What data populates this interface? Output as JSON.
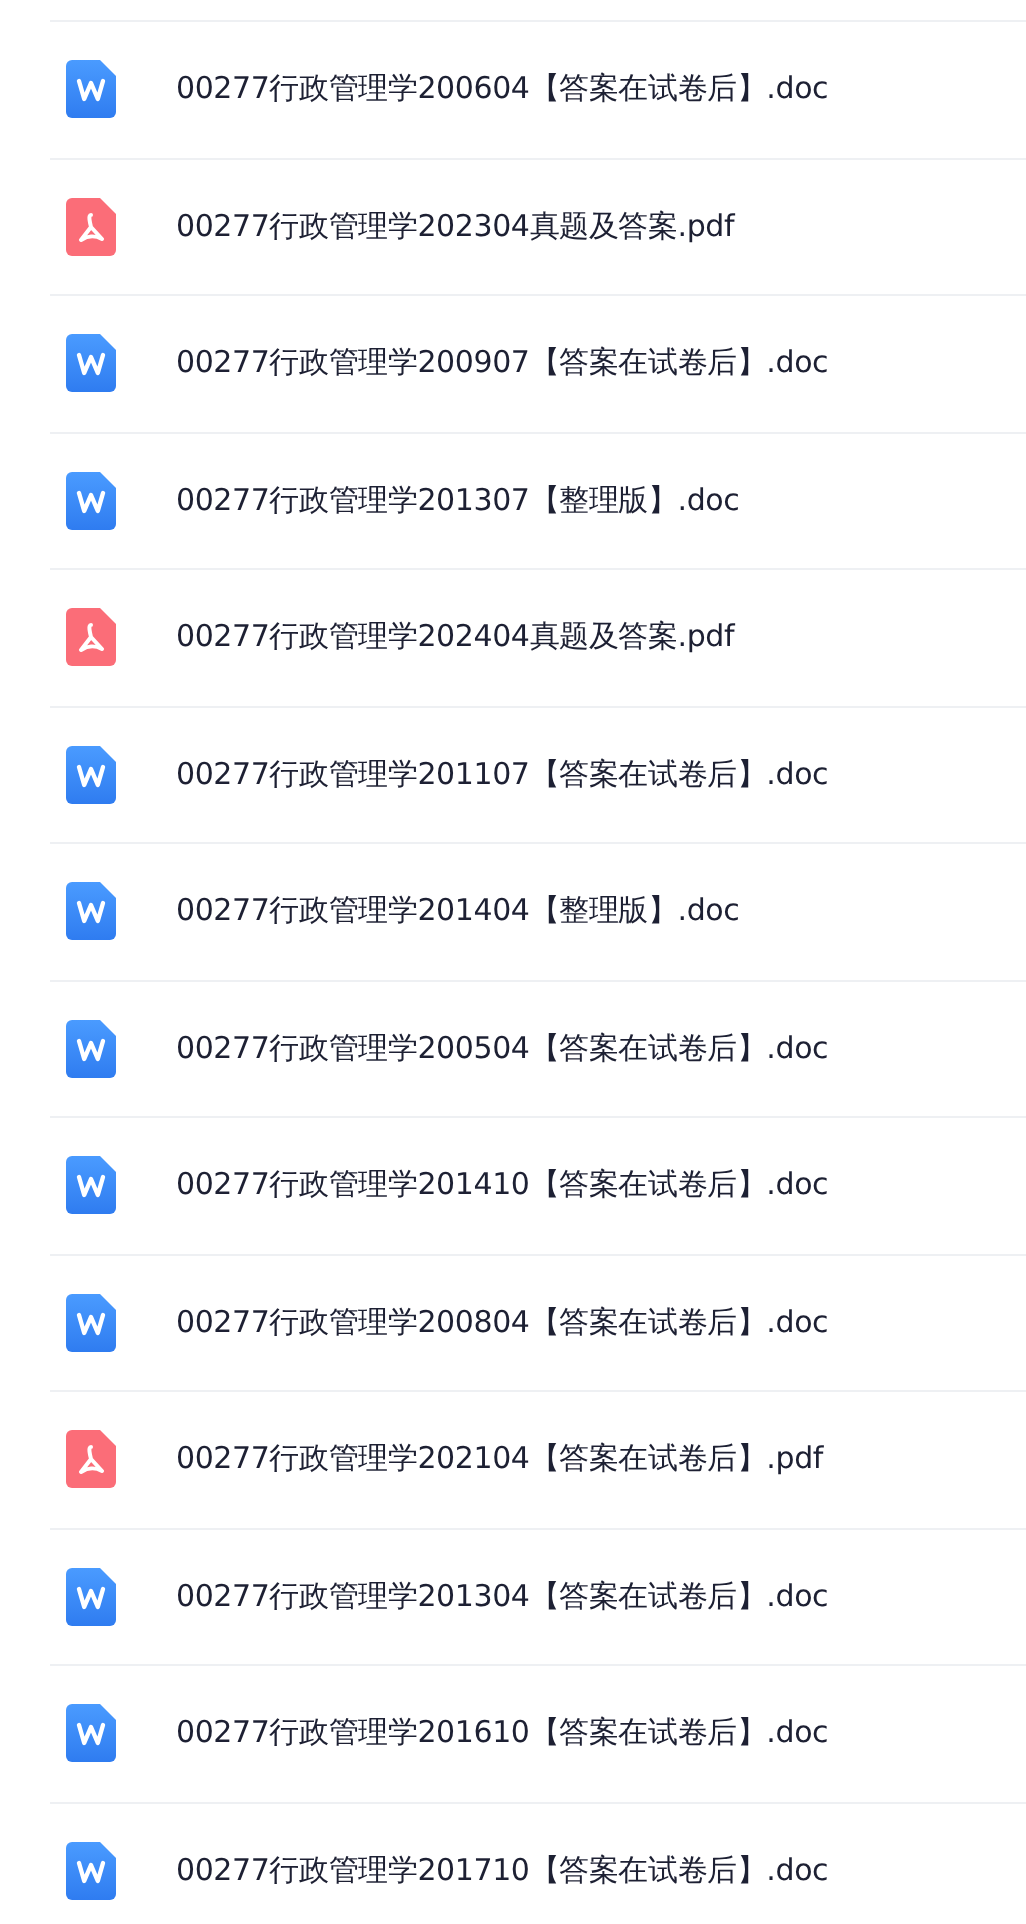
{
  "files": [
    {
      "kind": "doc",
      "name": "00277行政管理学200604【答案在试卷后】.doc"
    },
    {
      "kind": "pdf",
      "name": "00277行政管理学202304真题及答案.pdf"
    },
    {
      "kind": "doc",
      "name": "00277行政管理学200907【答案在试卷后】.doc"
    },
    {
      "kind": "doc",
      "name": "00277行政管理学201307【整理版】.doc"
    },
    {
      "kind": "pdf",
      "name": "00277行政管理学202404真题及答案.pdf"
    },
    {
      "kind": "doc",
      "name": "00277行政管理学201107【答案在试卷后】.doc"
    },
    {
      "kind": "doc",
      "name": "00277行政管理学201404【整理版】.doc"
    },
    {
      "kind": "doc",
      "name": "00277行政管理学200504【答案在试卷后】.doc"
    },
    {
      "kind": "doc",
      "name": "00277行政管理学201410【答案在试卷后】.doc"
    },
    {
      "kind": "doc",
      "name": "00277行政管理学200804【答案在试卷后】.doc"
    },
    {
      "kind": "pdf",
      "name": "00277行政管理学202104【答案在试卷后】.pdf"
    },
    {
      "kind": "doc",
      "name": "00277行政管理学201304【答案在试卷后】.doc"
    },
    {
      "kind": "doc",
      "name": "00277行政管理学201610【答案在试卷后】.doc"
    },
    {
      "kind": "doc",
      "name": "00277行政管理学201710【答案在试卷后】.doc"
    }
  ]
}
